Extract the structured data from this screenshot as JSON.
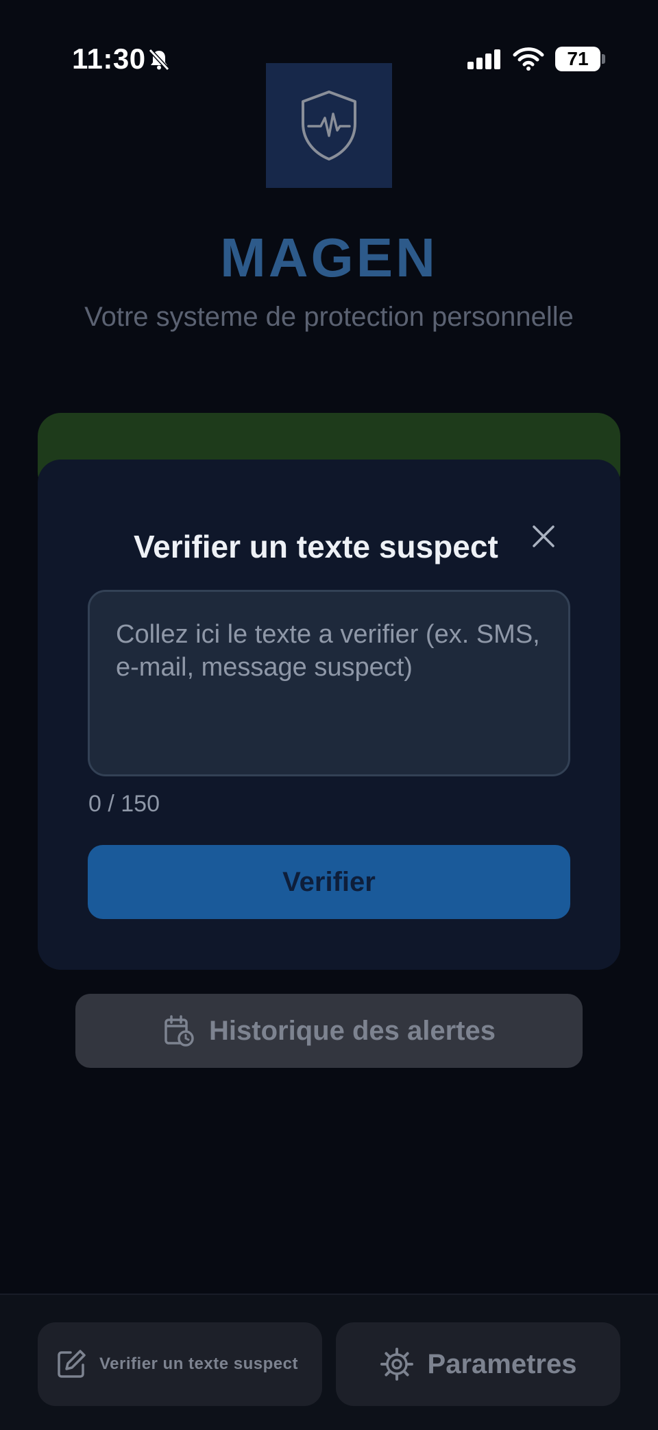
{
  "status_bar": {
    "time": "11:30",
    "battery": "71",
    "icons": [
      "bell-slash-icon",
      "cellular-signal-icon",
      "wifi-icon",
      "battery-icon"
    ]
  },
  "header": {
    "logo_icon": "shield-heartbeat-icon",
    "title": "MAGEN",
    "subtitle": "Votre systeme de protection personnelle"
  },
  "modal": {
    "title": "Verifier un texte suspect",
    "close_icon": "close-icon",
    "input_value": "",
    "input_placeholder": "Collez ici le texte a verifier (ex. SMS, e-mail, message suspect)",
    "char_counter": "0 / 150",
    "submit_label": "Verifier"
  },
  "history": {
    "icon": "calendar-clock-icon",
    "label": "Historique des alertes"
  },
  "bottom_nav": {
    "items": [
      {
        "icon": "edit-icon",
        "label": "Verifier un texte suspect"
      },
      {
        "icon": "gear-icon",
        "label": "Parametres"
      }
    ]
  },
  "colors": {
    "background": "#070a12",
    "modal_bg": "#0f172a",
    "accent_blue": "#1a5a9a",
    "title_blue": "#2d5a8a",
    "green_card": "#1e3b1b"
  }
}
